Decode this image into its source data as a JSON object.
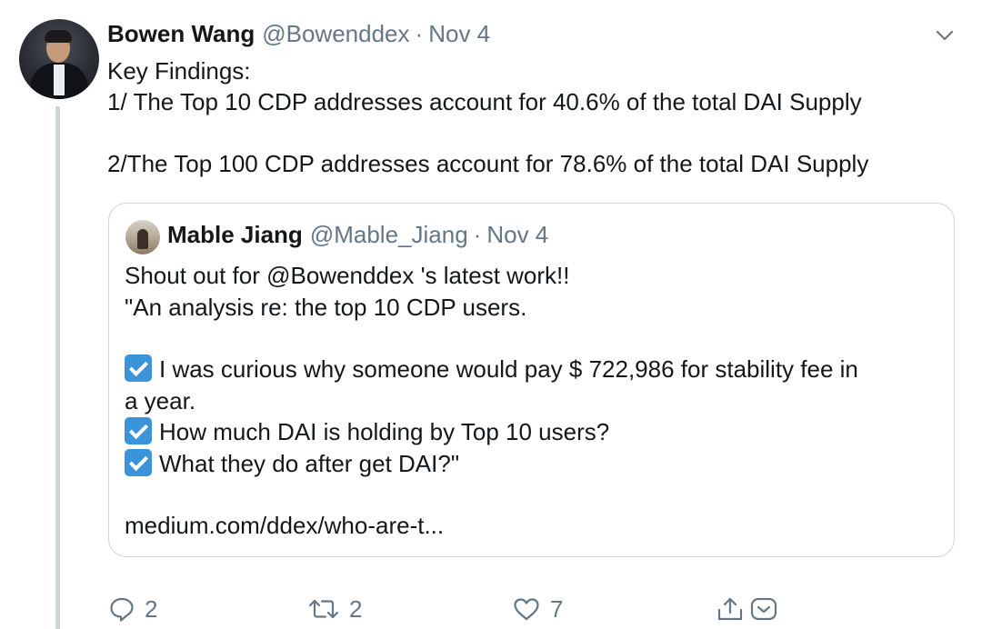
{
  "tweet": {
    "name": "Bowen Wang",
    "handle": "@Bowenddex",
    "separator": "·",
    "date": "Nov 4",
    "lines": [
      "Key Findings:",
      "1/ The Top 10 CDP addresses account for 40.6% of the total DAI Supply",
      "2/The Top 100 CDP addresses account for 78.6% of the total DAI Supply"
    ]
  },
  "quote": {
    "name": "Mable Jiang",
    "handle": "@Mable_Jiang",
    "separator": "·",
    "date": "Nov 4",
    "lines": [
      "Shout out for @Bowenddex 's latest work!!",
      "\"An analysis re: the top 10 CDP users."
    ],
    "checklist": [
      "I was curious why someone would pay $ 722,986 for stability fee in",
      "a year.",
      "How much DAI is holding by Top 10 users?",
      "What they do after get DAI?\""
    ],
    "link": "medium.com/ddex/who-are-t..."
  },
  "actions": {
    "reply_count": "2",
    "retweet_count": "2",
    "like_count": "7"
  },
  "colors": {
    "text": "#14171a",
    "secondary": "#657786",
    "border": "#ccd6dd",
    "checkbox": "#3b94d9"
  }
}
